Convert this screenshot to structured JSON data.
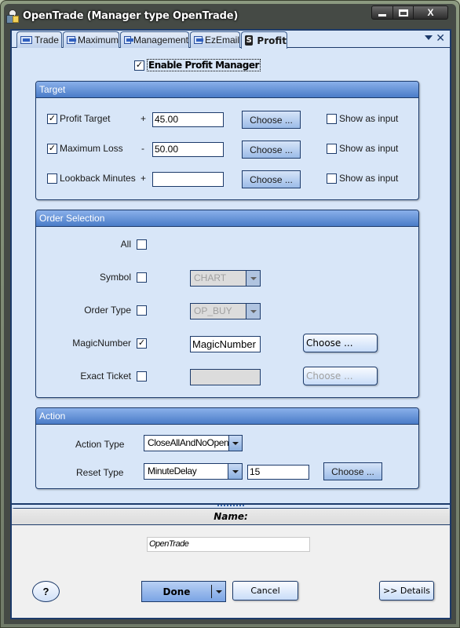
{
  "window": {
    "title": "OpenTrade (Manager type OpenTrade)",
    "controls": {
      "minimize": "minimize",
      "maximize": "maximize",
      "close": "X"
    }
  },
  "tabs": [
    {
      "label": "Trade",
      "icon": "window-icon",
      "active": false
    },
    {
      "label": "Maximum",
      "icon": "window-icon",
      "active": false
    },
    {
      "label": "Management",
      "icon": "window-icon",
      "active": false
    },
    {
      "label": "EzEmail",
      "icon": "window-icon",
      "active": false
    },
    {
      "label": "Profit",
      "icon": "S",
      "active": true
    }
  ],
  "tab_actions": {
    "menu": "▼",
    "close": "✕"
  },
  "enable": {
    "label": "Enable Profit Manager",
    "checked": true
  },
  "target": {
    "title": "Target",
    "rows": [
      {
        "label": "Profit Target",
        "checked": true,
        "sign": "+",
        "value": "45.00",
        "choose": "Choose ...",
        "show_label": "Show as input",
        "show_checked": false
      },
      {
        "label": "Maximum Loss",
        "checked": true,
        "sign": "-",
        "value": "50.00",
        "choose": "Choose ...",
        "show_label": "Show as input",
        "show_checked": false
      },
      {
        "label": "Lookback Minutes",
        "checked": false,
        "sign": "+",
        "value": "",
        "choose": "Choose ...",
        "show_label": "Show as input",
        "show_checked": false
      }
    ]
  },
  "order_selection": {
    "title": "Order Selection",
    "all": {
      "label": "All",
      "checked": false
    },
    "symbol": {
      "label": "Symbol",
      "checked": false,
      "value": "CHART"
    },
    "order_type": {
      "label": "Order Type",
      "checked": false,
      "value": "OP_BUY"
    },
    "magic_number": {
      "label": "MagicNumber",
      "checked": true,
      "value": "MagicNumber",
      "choose": "Choose ..."
    },
    "exact_ticket": {
      "label": "Exact Ticket",
      "checked": false,
      "value": "",
      "choose": "Choose ..."
    }
  },
  "action": {
    "title": "Action",
    "action_type": {
      "label": "Action Type",
      "value": "CloseAllAndNoOpen"
    },
    "reset_type": {
      "label": "Reset Type",
      "value": "MinuteDelay",
      "amount": "15",
      "choose": "Choose ..."
    }
  },
  "name_panel": {
    "header": "Name:",
    "value": "OpenTrade"
  },
  "footer": {
    "help": "?",
    "done": "Done",
    "cancel": "Cancel",
    "details": ">> Details"
  },
  "check_glyph": "✓"
}
